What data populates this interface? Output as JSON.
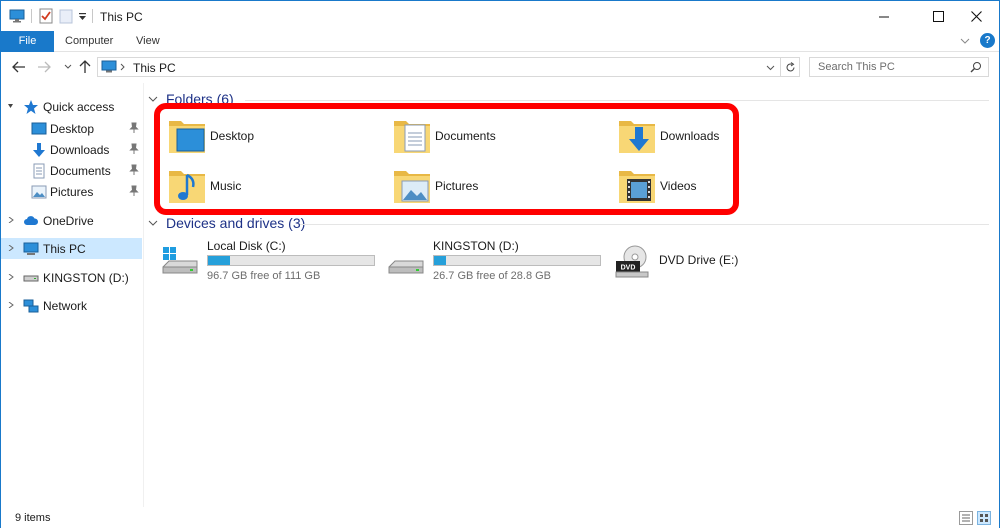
{
  "window": {
    "title": "This PC"
  },
  "ribbon": {
    "tabs": [
      "File",
      "Computer",
      "View"
    ]
  },
  "address": {
    "path": "This PC",
    "search_placeholder": "Search This PC"
  },
  "nav": {
    "quick_access": "Quick access",
    "pinned": [
      "Desktop",
      "Downloads",
      "Documents",
      "Pictures"
    ],
    "onedrive": "OneDrive",
    "this_pc": "This PC",
    "kingston": "KINGSTON (D:)",
    "network": "Network"
  },
  "folders": {
    "header": "Folders (6)",
    "items": [
      "Desktop",
      "Documents",
      "Downloads",
      "Music",
      "Pictures",
      "Videos"
    ]
  },
  "drives": {
    "header": "Devices and drives (3)",
    "items": [
      {
        "name": "Local Disk (C:)",
        "free": "96.7 GB free of 111 GB",
        "used_fraction": 0.13
      },
      {
        "name": "KINGSTON (D:)",
        "free": "26.7 GB free of 28.8 GB",
        "used_fraction": 0.07
      },
      {
        "name": "DVD Drive (E:)"
      }
    ]
  },
  "status": {
    "items": "9 items"
  },
  "colors": {
    "accent": "#1979ca",
    "selection": "#cce8ff",
    "highlight": "#ff0000",
    "bar": "#26a0da"
  }
}
